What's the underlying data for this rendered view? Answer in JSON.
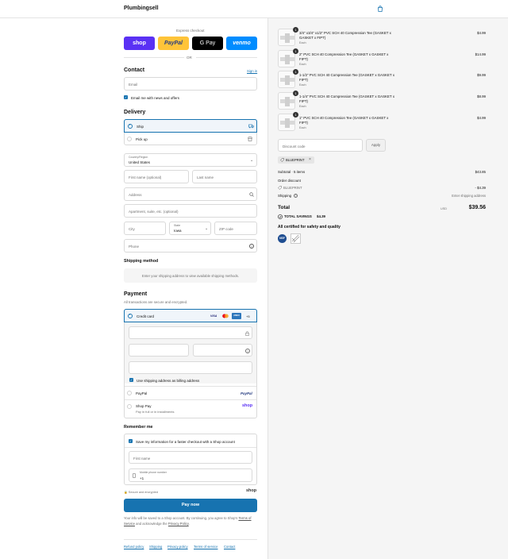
{
  "store": {
    "name": "Plumbingsell"
  },
  "express": {
    "title": "Express checkout",
    "shop_label": "shop",
    "paypal_label": "PayPal",
    "gpay_label": "G Pay",
    "venmo_label": "venmo",
    "or_label": "OR"
  },
  "contact": {
    "heading": "Contact",
    "sign_in": "Sign in",
    "email_placeholder": "Email",
    "news_label": "Email me with news and offers"
  },
  "delivery": {
    "heading": "Delivery",
    "ship_label": "Ship",
    "pickup_label": "Pick up",
    "country_label": "Country/Region",
    "country_value": "United States",
    "first_name": "First name (optional)",
    "last_name": "Last name",
    "address": "Address",
    "apartment": "Apartment, suite, etc. (optional)",
    "city": "City",
    "state_label": "State",
    "state_value": "Iowa",
    "zip": "ZIP code",
    "phone": "Phone"
  },
  "shipping_method": {
    "heading": "Shipping method",
    "note": "Enter your shipping address to view available shipping methods."
  },
  "payment": {
    "heading": "Payment",
    "subtitle": "All transactions are secure and encrypted.",
    "credit_card_label": "Credit card",
    "card_visa": "VISA",
    "card_amex": "AMEX",
    "card_more": "+5",
    "billing_label": "Use shipping address as billing address",
    "paypal_label": "PayPal",
    "paypal_logo": "PayPal",
    "shoppay_label": "Shop Pay",
    "shoppay_sub": "Pay in full or in installments",
    "shoppay_logo": "shop"
  },
  "remember": {
    "heading": "Remember me",
    "save_label": "Save my information for a faster checkout with a Shop account",
    "first_name": "First name",
    "phone_label": "Mobile phone number",
    "phone_value": "+1",
    "secure_label": "Secure and encrypted",
    "shop_logo": "shop"
  },
  "pay_button": "Pay now",
  "legal": {
    "text1": "Your info will be saved to a Shop account. By continuing, you agree to Shop's",
    "terms": "Terms of Service",
    "text2": "and acknowledge the",
    "privacy": "Privacy Policy",
    "dot": "."
  },
  "footer_links": [
    "Refund policy",
    "Shipping",
    "Privacy policy",
    "Terms of service",
    "Contact"
  ],
  "cart": {
    "items": [
      {
        "qty": "1",
        "name": "3/4\" x3/4\" x1/2\" PVC SCH 40 Compression Tee (GASKET x GASKET x FIPT)",
        "variant": "Each",
        "price": "$4.99"
      },
      {
        "qty": "1",
        "name": "2\" PVC SCH 40 Compression Tee (GASKET x GASKET x FIPT)",
        "variant": "Each",
        "price": "$14.99"
      },
      {
        "qty": "1",
        "name": "1-1/2\" PVC SCH 40 Compression Tee (GASKET x GASKET x FIPT)",
        "variant": "Each",
        "price": "$9.99"
      },
      {
        "qty": "1",
        "name": "1-1/4\" PVC SCH 40 Compression Tee (GASKET x GASKET x FIPT)",
        "variant": "Each",
        "price": "$8.99"
      },
      {
        "qty": "1",
        "name": "1\" PVC SCH 40 Compression Tee (GASKET x GASKET x FIPT)",
        "variant": "Each",
        "price": "$4.99"
      }
    ],
    "discount_placeholder": "Discount code",
    "apply_label": "Apply",
    "code_tag": "BLUEPRINT",
    "subtotal_label": "Subtotal · 5 items",
    "subtotal_value": "$43.85",
    "order_discount_label": "Order discount",
    "discount_code": "BLUEPRINT",
    "discount_value": "- $4.39",
    "shipping_label": "Shipping",
    "shipping_value": "Enter shipping address",
    "total_label": "Total",
    "currency": "USD",
    "total_value": "$39.56",
    "savings_label": "TOTAL SAVINGS",
    "savings_value": "$4.39",
    "certified": "All certified for safety and quality",
    "nsf_label": "NSF"
  },
  "colors": {
    "accent": "#1773b0",
    "shop_purple": "#5a31f4",
    "paypal_yellow": "#ffc439",
    "venmo_blue": "#008cff"
  }
}
